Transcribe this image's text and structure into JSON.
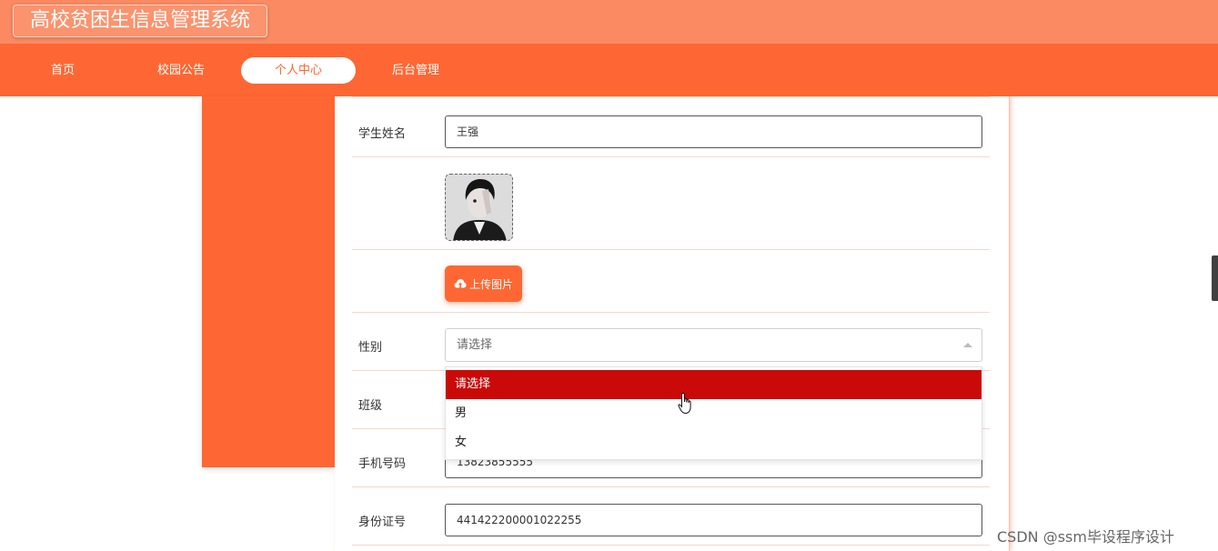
{
  "header": {
    "title": "高校贫困生信息管理系统"
  },
  "nav": {
    "items": [
      {
        "label": "首页"
      },
      {
        "label": "校园公告"
      },
      {
        "label": "个人中心"
      },
      {
        "label": "后台管理"
      }
    ],
    "active_label": "个人中心"
  },
  "form": {
    "name_label": "学生姓名",
    "name_value": "王强",
    "upload_label": "上传图片",
    "gender_label": "性别",
    "gender_placeholder": "请选择",
    "gender_options": [
      "请选择",
      "男",
      "女"
    ],
    "gender_highlighted": "请选择",
    "class_label": "班级",
    "phone_label": "手机号码",
    "phone_value": "13823855555",
    "id_label": "身份证号",
    "id_value": "441422200001022255"
  },
  "watermark": "CSDN @ssm毕设程序设计",
  "colors": {
    "title_bar": "#fb8a62",
    "nav_bar": "#fe6733",
    "accent": "#fe6733",
    "option_highlight": "#c90a08"
  },
  "icons": {
    "upload": "cloud-upload-icon",
    "select_caret": "caret-up-icon",
    "pointer": "hand-pointer-icon"
  }
}
